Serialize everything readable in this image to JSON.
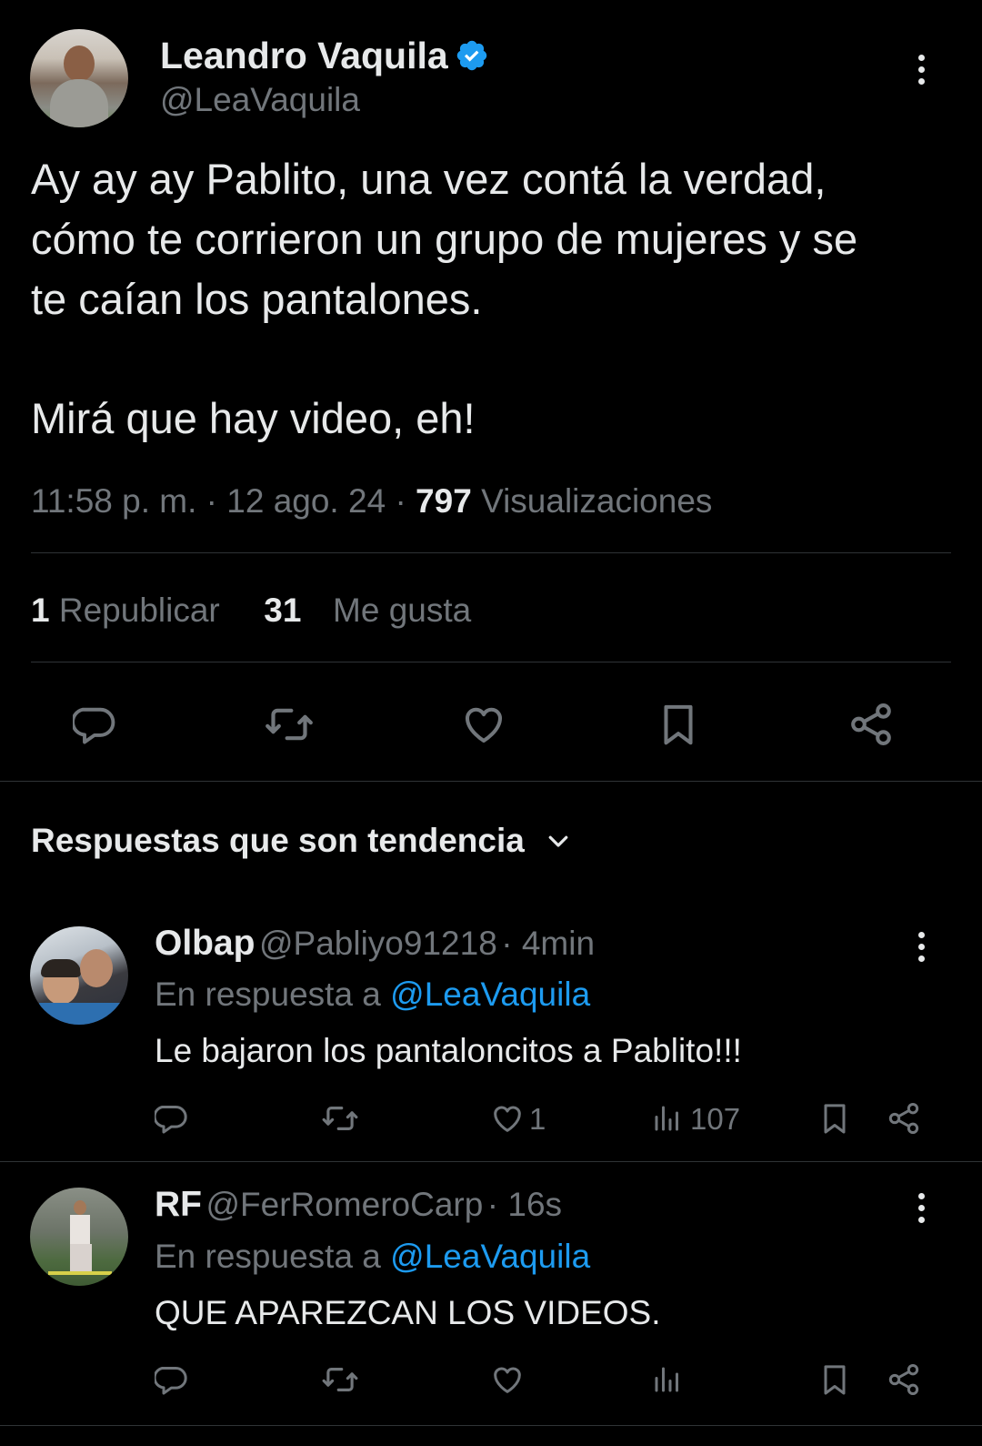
{
  "tweet": {
    "author_name": "Leandro Vaquila",
    "author_handle": "@LeaVaquila",
    "text_line1": "Ay ay ay Pablito, una vez contá la verdad,",
    "text_line2": "cómo te corrieron un grupo de mujeres y se",
    "text_line3": "te caían los pantalones.",
    "text_line4": "Mirá que hay video, eh!",
    "time": "11:58 p. m.",
    "date": "12 ago. 24",
    "views_count": "797",
    "views_label": "Visualizaciones",
    "reposts_count": "1",
    "reposts_label": "Republicar",
    "likes_count": "31",
    "likes_label": "Me gusta"
  },
  "replies_header": {
    "label": "Respuestas que son tendencia"
  },
  "replies": [
    {
      "name": "Olbap",
      "handle": "@Pabliyo91218",
      "age": "4min",
      "in_reply_prefix": "En respuesta a",
      "in_reply_to": "@LeaVaquila",
      "text": "Le bajaron los pantaloncitos a Pablito!!!",
      "likes": "1",
      "views": "107"
    },
    {
      "name": "RF",
      "handle": "@FerRomeroCarp",
      "age": "16s",
      "in_reply_prefix": "En respuesta a",
      "in_reply_to": "@LeaVaquila",
      "text": "QUE APAREZCAN LOS VIDEOS.",
      "likes": "",
      "views": ""
    }
  ],
  "colors": {
    "background": "#000000",
    "text": "#e7e9ea",
    "muted": "#71767b",
    "accent": "#1d9bf0",
    "divider": "#2f3336"
  },
  "icons": [
    "verified-badge-icon",
    "more-icon",
    "reply-icon",
    "repost-icon",
    "like-icon",
    "bookmark-icon",
    "share-icon",
    "views-icon",
    "chevron-down-icon"
  ]
}
